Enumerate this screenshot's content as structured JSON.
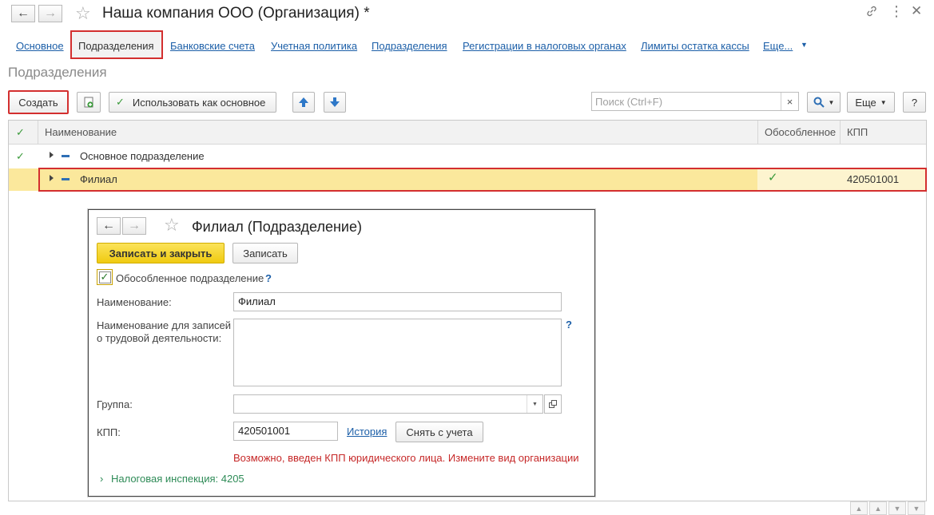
{
  "window": {
    "title": "Наша компания ООО (Организация) *"
  },
  "tabs": [
    {
      "label": "Основное"
    },
    {
      "label": "Подразделения"
    },
    {
      "label": "Банковские счета"
    },
    {
      "label": "Учетная политика"
    },
    {
      "label": "Подразделения"
    },
    {
      "label": "Регистрации в налоговых органах"
    },
    {
      "label": "Лимиты остатка кассы"
    },
    {
      "label": "Еще..."
    }
  ],
  "section_title": "Подразделения",
  "toolbar": {
    "create_label": "Создать",
    "use_main_label": "Использовать как основное",
    "search_placeholder": "Поиск (Ctrl+F)",
    "clear_label": "×",
    "more_label": "Еще",
    "help_label": "?"
  },
  "table": {
    "columns": {
      "name": "Наименование",
      "separate": "Обособленное",
      "kpp": "КПП"
    },
    "rows": [
      {
        "name": "Основное подразделение",
        "separate": false,
        "kpp": ""
      },
      {
        "name": "Филиал",
        "separate": true,
        "kpp": "420501001"
      }
    ]
  },
  "dialog": {
    "title": "Филиал (Подразделение)",
    "save_close_label": "Записать и закрыть",
    "save_label": "Записать",
    "separate_checkbox_label": "Обособленное подразделение",
    "separate_checked": true,
    "name_label": "Наименование:",
    "name_value": "Филиал",
    "labor_name_label_1": "Наименование для записей",
    "labor_name_label_2": "о трудовой деятельности:",
    "labor_name_value": "",
    "group_label": "Группа:",
    "group_value": "",
    "kpp_label": "КПП:",
    "kpp_value": "420501001",
    "history_label": "История",
    "deregister_label": "Снять с учета",
    "warning": "Возможно, введен КПП юридического лица. Измените вид организации",
    "tax_inspection": "Налоговая инспекция: 4205",
    "help_mark": "?"
  },
  "colors": {
    "accent_yellow": "#f5d21c",
    "highlight_red": "#d32f2f",
    "link_blue": "#1c5fa8",
    "row_selected": "#fbe89c",
    "check_green": "#3a9a3a"
  }
}
